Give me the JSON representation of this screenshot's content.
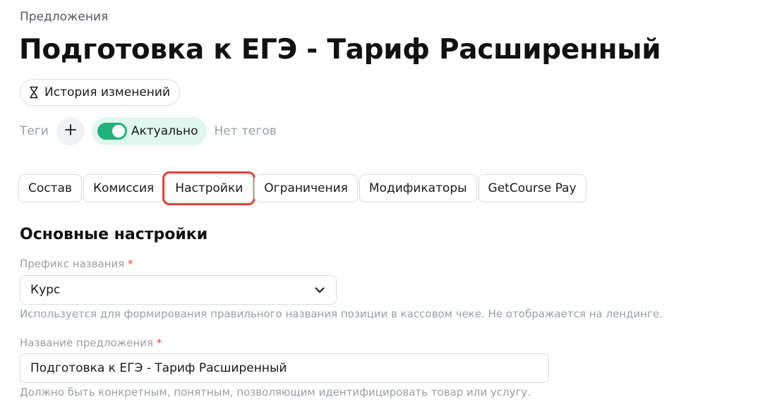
{
  "breadcrumb": "Предложения",
  "title": "Подготовка к ЕГЭ - Тариф Расширенный",
  "history_button": {
    "label": "История изменений",
    "icon": "hourglass-icon"
  },
  "tags": {
    "label": "Теги",
    "add_icon": "plus-icon",
    "status_label": "Актуально",
    "status_toggle_on": true,
    "no_tags_text": "Нет тегов"
  },
  "tabs": [
    {
      "label": "Состав",
      "active": false
    },
    {
      "label": "Комиссия",
      "active": false
    },
    {
      "label": "Настройки",
      "active": true
    },
    {
      "label": "Ограничения",
      "active": false
    },
    {
      "label": "Модификаторы",
      "active": false
    },
    {
      "label": "GetCourse Pay",
      "active": false
    }
  ],
  "main_settings": {
    "title": "Основные настройки",
    "prefix_field": {
      "label": "Префикс названия",
      "required_mark": "*",
      "value": "Курс",
      "hint": "Используется для формирования правильного названия позиции в кассовом чеке. Не отображается на лендинге."
    },
    "name_field": {
      "label": "Название предложения",
      "required_mark": "*",
      "value": "Подготовка к ЕГЭ - Тариф Расширенный",
      "hint": "Должно быть конкретным, понятным, позволяющим идентифицировать товар или услугу."
    }
  },
  "colors": {
    "accent_green": "#22b07d",
    "status_pill_bg": "#dff7ee",
    "active_tab_outline": "#d9433a",
    "required_mark": "#e0483d"
  }
}
